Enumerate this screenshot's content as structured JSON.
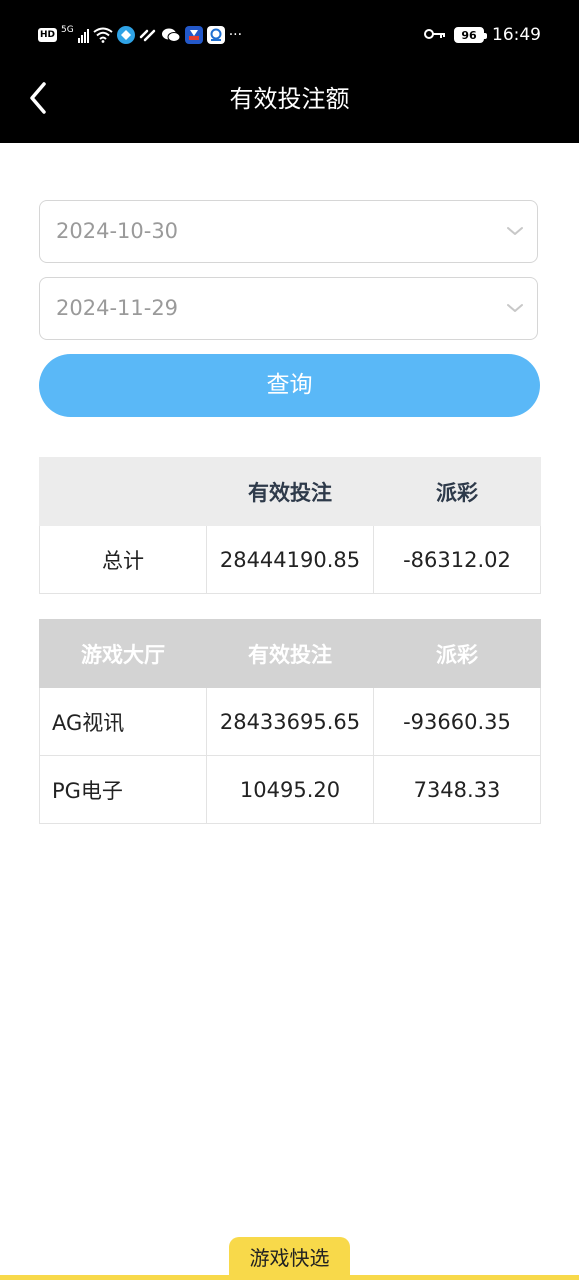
{
  "status_bar": {
    "hd": "HD",
    "network": "5G",
    "time": "16:49",
    "battery": "96",
    "more": "···"
  },
  "header": {
    "title": "有效投注额"
  },
  "filters": {
    "start_date": "2024-10-30",
    "end_date": "2024-11-29",
    "query_button": "查询"
  },
  "summary_table": {
    "headers": [
      "",
      "有效投注",
      "派彩"
    ],
    "rows": [
      [
        "总计",
        "28444190.85",
        "-86312.02"
      ]
    ]
  },
  "detail_table": {
    "headers": [
      "游戏大厅",
      "有效投注",
      "派彩"
    ],
    "rows": [
      [
        "AG视讯",
        "28433695.65",
        "-93660.35"
      ],
      [
        "PG电子",
        "10495.20",
        "7348.33"
      ]
    ]
  },
  "fab": {
    "label": "游戏快选"
  },
  "colors": {
    "accent_blue": "#5ab8f7",
    "fab_yellow": "#f8d94a",
    "header_black": "#000000"
  }
}
